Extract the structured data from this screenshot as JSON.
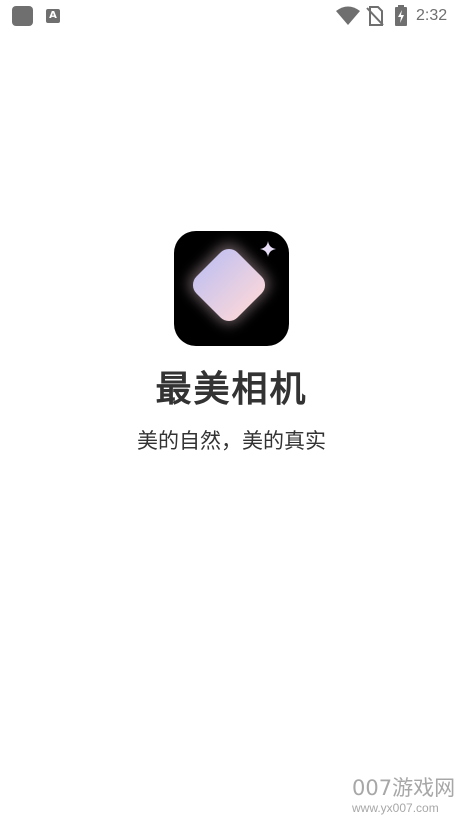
{
  "status_bar": {
    "time": "2:32",
    "notification_letter": "A",
    "icons": [
      "app-notification-icon",
      "a-notification-icon",
      "wifi-icon",
      "no-sim-icon",
      "battery-charging-icon"
    ],
    "icon_color": "#6f6f6f"
  },
  "splash": {
    "app_name": "最美相机",
    "slogan": "美的自然，美的真实",
    "icon": "diamond-logo-icon",
    "icon_background": "#000000",
    "text_color": "#333333"
  },
  "watermark": {
    "title": "007游戏网",
    "url": "www.yx007.com"
  }
}
